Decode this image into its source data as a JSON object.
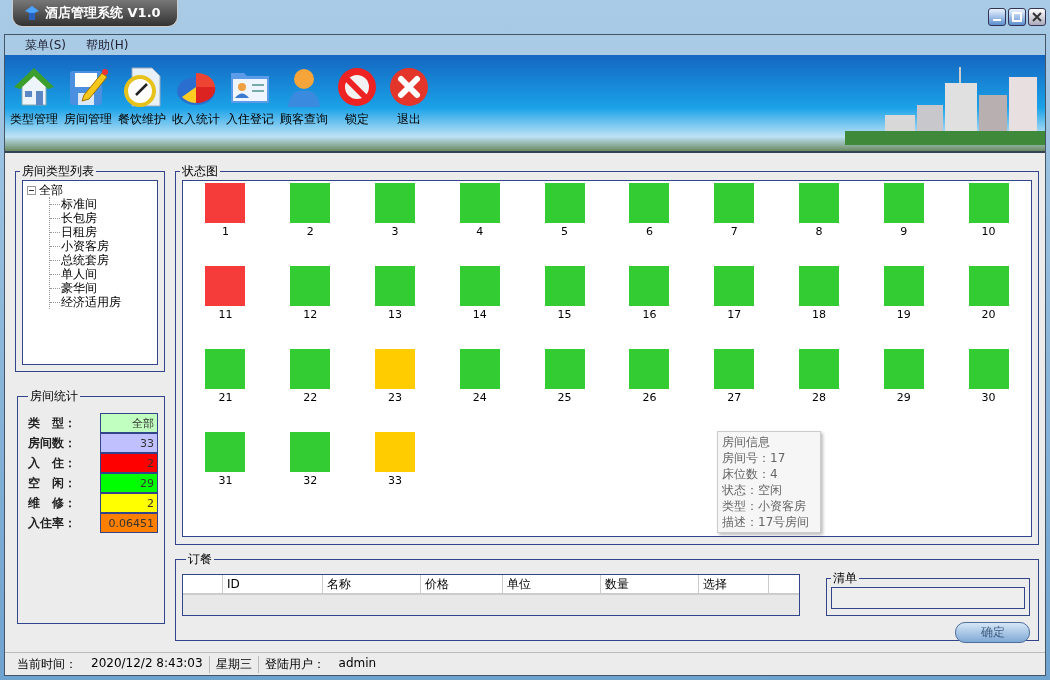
{
  "window": {
    "title": "酒店管理系统 V1.0"
  },
  "menu": [
    {
      "label": "菜单(S)"
    },
    {
      "label": "帮助(H)"
    }
  ],
  "toolbar": [
    {
      "label": "类型管理"
    },
    {
      "label": "房间管理"
    },
    {
      "label": "餐饮维护"
    },
    {
      "label": "收入统计"
    },
    {
      "label": "入住登记"
    },
    {
      "label": "顾客查询"
    },
    {
      "label": "锁定"
    },
    {
      "label": "退出"
    }
  ],
  "room_types": {
    "title": "房间类型列表",
    "tree": [
      {
        "label": "全部",
        "expanded": true,
        "children": [
          {
            "label": "标准间"
          },
          {
            "label": "长包房"
          },
          {
            "label": "日租房"
          },
          {
            "label": "小资客房"
          },
          {
            "label": "总统套房"
          },
          {
            "label": "单人间"
          },
          {
            "label": "豪华间"
          },
          {
            "label": "经济适用房"
          }
        ]
      }
    ]
  },
  "room_stats": {
    "title": "房间统计",
    "items": [
      {
        "label": "类　型：",
        "value": "全部",
        "color": "#c0ffc0"
      },
      {
        "label": "房间数：",
        "value": "33",
        "color": "#c0c0ff"
      },
      {
        "label": "入　住：",
        "value": "2",
        "color": "#ff0000"
      },
      {
        "label": "空　闲：",
        "value": "29",
        "color": "#00ff00"
      },
      {
        "label": "维　修：",
        "value": "2",
        "color": "#ffff00"
      },
      {
        "label": "入住率：",
        "value": "0.06451",
        "color": "#ff8000"
      }
    ]
  },
  "status_map": {
    "title": "状态图",
    "rooms": [
      {
        "number": "1",
        "color": "#f63b3b"
      },
      {
        "number": "2",
        "color": "#33cc33"
      },
      {
        "number": "3",
        "color": "#33cc33"
      },
      {
        "number": "4",
        "color": "#33cc33"
      },
      {
        "number": "5",
        "color": "#33cc33"
      },
      {
        "number": "6",
        "color": "#33cc33"
      },
      {
        "number": "7",
        "color": "#33cc33"
      },
      {
        "number": "8",
        "color": "#33cc33"
      },
      {
        "number": "9",
        "color": "#33cc33"
      },
      {
        "number": "10",
        "color": "#33cc33"
      },
      {
        "number": "11",
        "color": "#f63b3b"
      },
      {
        "number": "12",
        "color": "#33cc33"
      },
      {
        "number": "13",
        "color": "#33cc33"
      },
      {
        "number": "14",
        "color": "#33cc33"
      },
      {
        "number": "15",
        "color": "#33cc33"
      },
      {
        "number": "16",
        "color": "#33cc33"
      },
      {
        "number": "17",
        "color": "#33cc33"
      },
      {
        "number": "18",
        "color": "#33cc33"
      },
      {
        "number": "19",
        "color": "#33cc33"
      },
      {
        "number": "20",
        "color": "#33cc33"
      },
      {
        "number": "21",
        "color": "#33cc33"
      },
      {
        "number": "22",
        "color": "#33cc33"
      },
      {
        "number": "23",
        "color": "#ffcc00"
      },
      {
        "number": "24",
        "color": "#33cc33"
      },
      {
        "number": "25",
        "color": "#33cc33"
      },
      {
        "number": "26",
        "color": "#33cc33"
      },
      {
        "number": "27",
        "color": "#33cc33"
      },
      {
        "number": "28",
        "color": "#33cc33"
      },
      {
        "number": "29",
        "color": "#33cc33"
      },
      {
        "number": "30",
        "color": "#33cc33"
      },
      {
        "number": "31",
        "color": "#33cc33"
      },
      {
        "number": "32",
        "color": "#33cc33"
      },
      {
        "number": "33",
        "color": "#ffcc00"
      }
    ],
    "tooltip": {
      "title": "房间信息",
      "lines": [
        "房间号：17",
        "床位数：4",
        "状态：空闲",
        "类型：小资客房",
        "描述：17号房间"
      ]
    }
  },
  "order": {
    "title": "订餐",
    "columns": [
      "ID",
      "名称",
      "价格",
      "单位",
      "数量",
      "选择"
    ],
    "list_title": "清单",
    "confirm": {
      "label": "确定",
      "disabled": true
    }
  },
  "status_bar": {
    "time_label": "当前时间：",
    "time": "2020/12/2 8:43:03",
    "weekday": "星期三",
    "user_label": "登陆用户：",
    "user": "admin"
  }
}
